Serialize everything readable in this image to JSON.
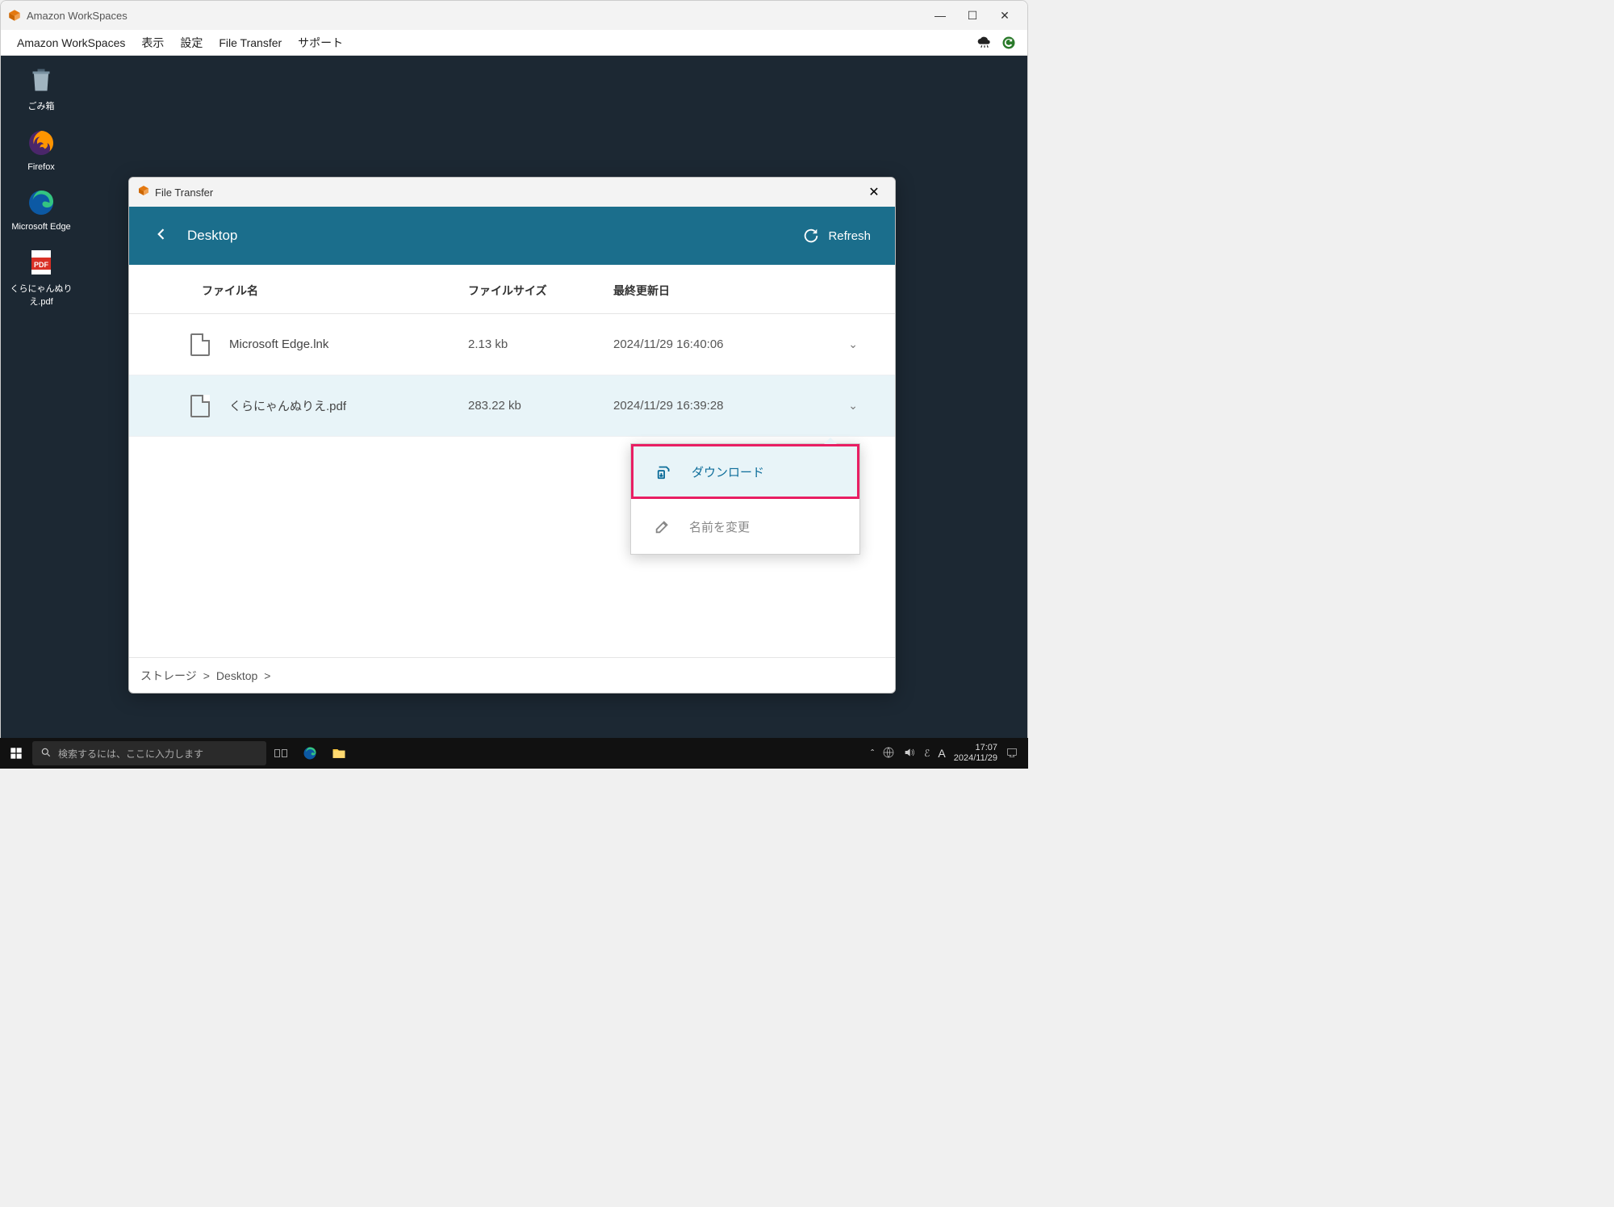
{
  "window": {
    "title": "Amazon WorkSpaces"
  },
  "menu": {
    "app": "Amazon WorkSpaces",
    "view": "表示",
    "settings": "設定",
    "file_transfer": "File Transfer",
    "support": "サポート"
  },
  "desktop_icons": {
    "trash": "ごみ箱",
    "firefox": "Firefox",
    "edge": "Microsoft Edge",
    "pdf": "くらにゃんぬりえ.pdf"
  },
  "file_transfer": {
    "title": "File Transfer",
    "location": "Desktop",
    "refresh": "Refresh",
    "columns": {
      "name": "ファイル名",
      "size": "ファイルサイズ",
      "date": "最終更新日"
    },
    "rows": [
      {
        "name": "Microsoft Edge.lnk",
        "size": "2.13 kb",
        "date": "2024/11/29 16:40:06"
      },
      {
        "name": "くらにゃんぬりえ.pdf",
        "size": "283.22 kb",
        "date": "2024/11/29 16:39:28"
      }
    ],
    "menu": {
      "download": "ダウンロード",
      "rename": "名前を変更"
    },
    "breadcrumb": {
      "root": "ストレージ",
      "current": "Desktop"
    }
  },
  "taskbar": {
    "search_placeholder": "検索するには、ここに入力します",
    "time": "17:07",
    "date": "2024/11/29",
    "ime": "A"
  }
}
